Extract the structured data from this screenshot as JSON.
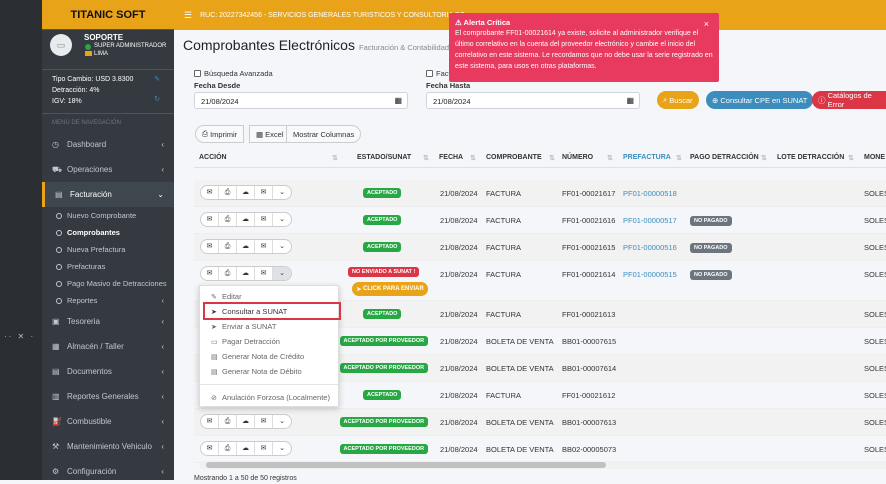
{
  "brand": "TITANIC SOFT",
  "user": {
    "name": "SOPORTE",
    "role": "SUPER ADMINISTRADOR",
    "location": "LIMA"
  },
  "info": {
    "tipo_cambio": "Tipo Cambio: USD 3.8300",
    "detraccion": "Detracción: 4%",
    "igv": "IGV: 18%"
  },
  "menu_header": "MENÚ DE NAVEGACIÓN",
  "menu": [
    {
      "label": "Dashboard",
      "icon": "dashboard-icon"
    },
    {
      "label": "Operaciones",
      "icon": "truck-icon"
    },
    {
      "label": "Facturación",
      "icon": "file-icon"
    },
    {
      "label": "Tesoreria",
      "icon": "money-icon"
    },
    {
      "label": "Almacén / Taller",
      "icon": "warehouse-icon"
    },
    {
      "label": "Documentos",
      "icon": "document-icon"
    },
    {
      "label": "Reportes Generales",
      "icon": "report-icon"
    },
    {
      "label": "Combustible",
      "icon": "fuel-icon"
    },
    {
      "label": "Mantenimiento Vehiculo",
      "icon": "wrench-icon"
    },
    {
      "label": "Configuración",
      "icon": "gear-icon"
    }
  ],
  "submenu": [
    "Nuevo Comprobante",
    "Comprobantes",
    "Nueva Prefactura",
    "Prefacturas",
    "Pago Masivo de Detracciones",
    "Reportes"
  ],
  "topbar": {
    "ruc": "RUC: 20227342456 - SERVICIOS GENERALES TURISTICOS Y CONSULTORIA SO"
  },
  "page": {
    "title": "Comprobantes Electrónicos",
    "subtitle": "Facturación & Contabilidad"
  },
  "filters": {
    "advanced": "Búsqueda Avanzada",
    "fact": "Fact",
    "fecha_desde_label": "Fecha Desde",
    "fecha_desde": "21/08/2024",
    "fecha_hasta_label": "Fecha Hasta",
    "fecha_hasta": "21/08/2024"
  },
  "buttons": {
    "buscar": "Buscar",
    "consultar": "Consultar CPE en SUNAT",
    "catalogos": "Catálogos de Error",
    "imprimir": "Imprimir",
    "excel": "Excel",
    "columnas": "Mostrar Columnas"
  },
  "alert": {
    "title": "Alerta Crítica",
    "body": "El comprobante FF01-00021614 ya existe, solicite al administrador verifique el último correlativo en la cuenta del proveedor electrónico y cambie el inicio del correlativo en este sistema. Le recordamos que no debe usar la serie registrado en este sistema, para usos en otras plataformas."
  },
  "table": {
    "headers": {
      "accion": "ACCIÓN",
      "estado": "ESTADO/SUNAT",
      "fecha": "FECHA",
      "comprobante": "COMPROBANTE",
      "numero": "NÚMERO",
      "prefactura": "PREFACTURA",
      "pago": "PAGO DETRACCIÓN",
      "lote": "LOTE DETRACCIÓN",
      "moneda": "MONE"
    },
    "rows": [
      {
        "estado": "ACEPTADO",
        "fecha": "21/08/2024",
        "comprobante": "FACTURA",
        "numero": "FF01-00021617",
        "prefactura": "PF01-00000518",
        "pago": "",
        "moneda": "SOLES"
      },
      {
        "estado": "ACEPTADO",
        "fecha": "21/08/2024",
        "comprobante": "FACTURA",
        "numero": "FF01-00021616",
        "prefactura": "PF01-00000517",
        "pago": "NO PAGADO",
        "moneda": "SOLES"
      },
      {
        "estado": "ACEPTADO",
        "fecha": "21/08/2024",
        "comprobante": "FACTURA",
        "numero": "FF01-00021615",
        "prefactura": "PF01-00000516",
        "pago": "NO PAGADO",
        "moneda": "SOLES"
      },
      {
        "estado": "NO ENVIADO A SUNAT !",
        "fecha": "21/08/2024",
        "comprobante": "FACTURA",
        "numero": "FF01-00021614",
        "prefactura": "PF01-00000515",
        "pago": "NO PAGADO",
        "moneda": "SOLES"
      },
      {
        "estado": "ACEPTADO",
        "fecha": "21/08/2024",
        "comprobante": "FACTURA",
        "numero": "FF01-00021613",
        "prefactura": "",
        "pago": "",
        "moneda": "SOLES"
      },
      {
        "estado": "ACEPTADO POR PROVEEDOR",
        "fecha": "21/08/2024",
        "comprobante": "BOLETA DE VENTA",
        "numero": "BB01-00007615",
        "prefactura": "",
        "pago": "",
        "moneda": "SOLES"
      },
      {
        "estado": "ACEPTADO POR PROVEEDOR",
        "fecha": "21/08/2024",
        "comprobante": "BOLETA DE VENTA",
        "numero": "BB01-00007614",
        "prefactura": "",
        "pago": "",
        "moneda": "SOLES"
      },
      {
        "estado": "ACEPTADO",
        "fecha": "21/08/2024",
        "comprobante": "FACTURA",
        "numero": "FF01-00021612",
        "prefactura": "",
        "pago": "",
        "moneda": "SOLES"
      },
      {
        "estado": "ACEPTADO POR PROVEEDOR",
        "fecha": "21/08/2024",
        "comprobante": "BOLETA DE VENTA",
        "numero": "BB01-00007613",
        "prefactura": "",
        "pago": "",
        "moneda": "SOLES"
      },
      {
        "estado": "ACEPTADO POR PROVEEDOR",
        "fecha": "21/08/2024",
        "comprobante": "BOLETA DE VENTA",
        "numero": "BB02-00005073",
        "prefactura": "",
        "pago": "",
        "moneda": "SOLES"
      }
    ]
  },
  "click_enviar": "CLICK PARA ENVIAR",
  "dropdown": [
    "Editar",
    "Consultar a SUNAT",
    "Enviar a SUNAT",
    "Pagar Detracción",
    "Generar Nota de Crédito",
    "Generar Nota de Débito",
    "Anulación Forzosa (Localmente)"
  ],
  "footer": "Mostrando 1 a 50 de 50 registros",
  "colors": {
    "accent": "#e8a319",
    "danger": "#dc3545",
    "success": "#28a745",
    "link": "#3c8dbc"
  }
}
